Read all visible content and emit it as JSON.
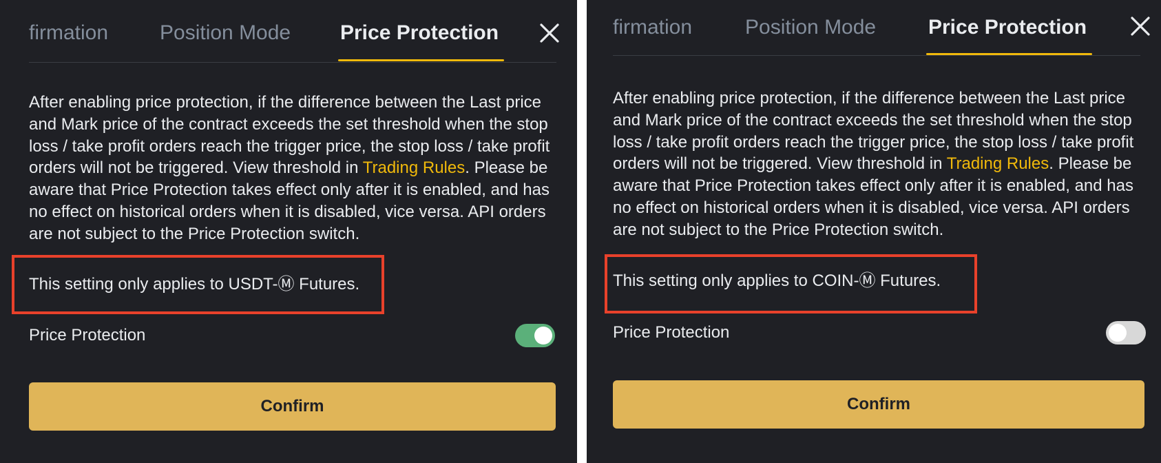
{
  "panels": [
    {
      "tabs": [
        "firmation",
        "Position Mode",
        "Price Protection"
      ],
      "active_tab": "Price Protection",
      "description": {
        "before_link": "After enabling price protection, if the difference between the Last price and Mark price of the contract exceeds the set threshold when the stop loss / take profit orders reach the trigger price, the stop loss / take profit orders will not be triggered. View threshold in ",
        "link": "Trading Rules",
        "after_link": ". Please be aware that Price Protection takes effect only after it is enabled, and has no effect on historical orders when it is disabled, vice versa. API orders are not subject to the Price Protection switch."
      },
      "note": "This setting only applies to USDT-Ⓜ Futures.",
      "toggle_label": "Price Protection",
      "toggle_on": true,
      "confirm_label": "Confirm"
    },
    {
      "tabs": [
        "firmation",
        "Position Mode",
        "Price Protection"
      ],
      "active_tab": "Price Protection",
      "description": {
        "before_link": "After enabling price protection, if the difference between the Last price and Mark price of the contract exceeds the set threshold when the stop loss / take profit orders reach the trigger price, the stop loss / take profit orders will not be triggered. View threshold in ",
        "link": "Trading Rules",
        "after_link": ". Please be aware that Price Protection takes effect only after it is enabled, and has no effect on historical orders when it is disabled, vice versa. API orders are not subject to the Price Protection switch."
      },
      "note": "This setting only applies to COIN-Ⓜ Futures.",
      "toggle_label": "Price Protection",
      "toggle_on": false,
      "confirm_label": "Confirm"
    }
  ],
  "icons": {
    "close": "close-icon"
  },
  "colors": {
    "panel_bg": "#1f2025",
    "accent": "#f0b90b",
    "confirm_bg": "#e0b558",
    "highlight": "#e8412b",
    "toggle_on": "#5bb07a",
    "toggle_off": "#d8d8d8"
  }
}
